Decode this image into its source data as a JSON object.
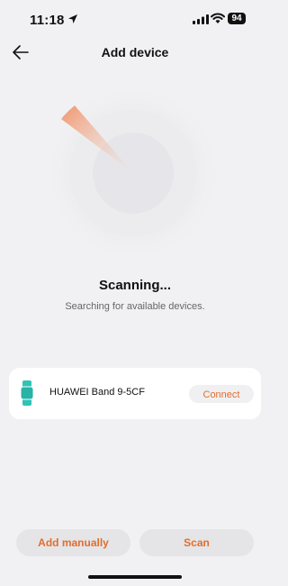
{
  "status_bar": {
    "time": "11:18",
    "battery": "94"
  },
  "nav": {
    "title": "Add device"
  },
  "scan": {
    "title": "Scanning...",
    "subtitle": "Searching for available devices."
  },
  "device": {
    "name": "HUAWEI Band 9-5CF",
    "action": "Connect",
    "icon": "band-icon"
  },
  "buttons": {
    "add_manually": "Add manually",
    "scan": "Scan"
  },
  "colors": {
    "accent": "#e26e2c",
    "band_icon": "#2ec4b6",
    "background": "#f1f1f3"
  }
}
